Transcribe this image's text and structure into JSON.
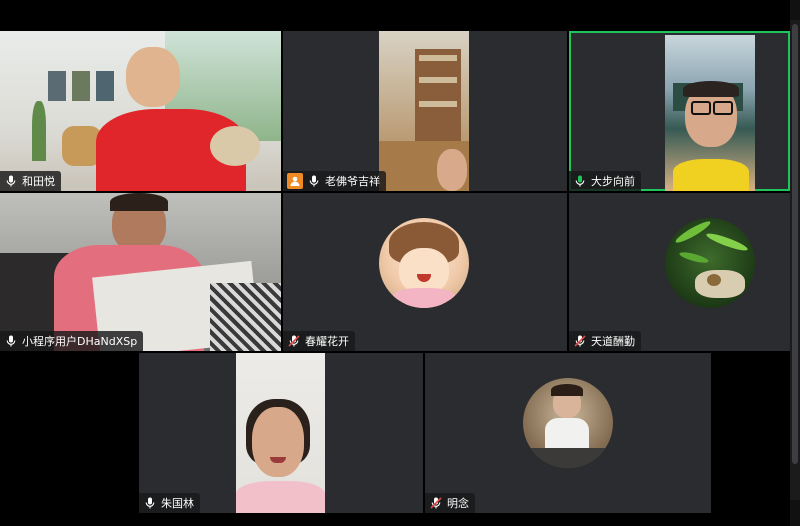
{
  "participants": [
    {
      "name": "和田悦",
      "mic": "on"
    },
    {
      "name": "老佛爷吉祥",
      "mic": "on",
      "host": true
    },
    {
      "name": "大步向前",
      "mic": "on",
      "speaking": true
    },
    {
      "name": "小程序用户DHaNdXSp",
      "mic": "on"
    },
    {
      "name": "春耀花开",
      "mic": "muted"
    },
    {
      "name": "天道酬勤",
      "mic": "muted"
    },
    {
      "name": "朱国林",
      "mic": "on"
    },
    {
      "name": "明念",
      "mic": "muted"
    }
  ],
  "colors": {
    "tile_bg": "#2b2c2f",
    "speaking_border": "#1fc45a",
    "host_badge": "#f08a24",
    "muted_red": "#e24a4a"
  }
}
